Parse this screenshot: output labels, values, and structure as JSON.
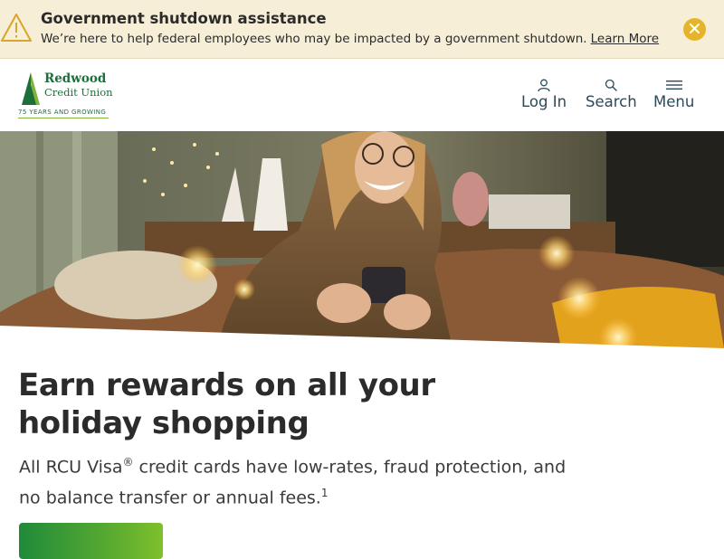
{
  "alert": {
    "title": "Government shutdown assistance",
    "body": "We’re here to help federal employees who may be impacted by a government shutdown.",
    "link": "Learn More",
    "icon": "warning-icon",
    "close_icon": "close-icon"
  },
  "header": {
    "logo": {
      "name_line1": "Redwood",
      "name_line2": "Credit Union",
      "tagline": "75 YEARS AND GROWING"
    },
    "nav": [
      {
        "label": "Log In",
        "icon": "user-icon"
      },
      {
        "label": "Search",
        "icon": "search-icon"
      },
      {
        "label": "Menu",
        "icon": "hamburger-icon"
      }
    ]
  },
  "hero": {
    "image": "woman-smiling-with-phone-holiday-lights"
  },
  "content": {
    "headline": "Earn rewards on all your holiday shopping",
    "subtext_part1": "All RCU Visa",
    "subtext_reg": "®",
    "subtext_part2": " credit cards have low-rates, fraud protection, and no balance transfer or annual fees.",
    "subtext_footnote": "1"
  },
  "colors": {
    "alert_bg": "#f6eed7",
    "close_bg": "#e6b429",
    "brand_green": "#1c6e3a",
    "cta_gradient_start": "#1f8a3a",
    "cta_gradient_end": "#7fc02c"
  }
}
